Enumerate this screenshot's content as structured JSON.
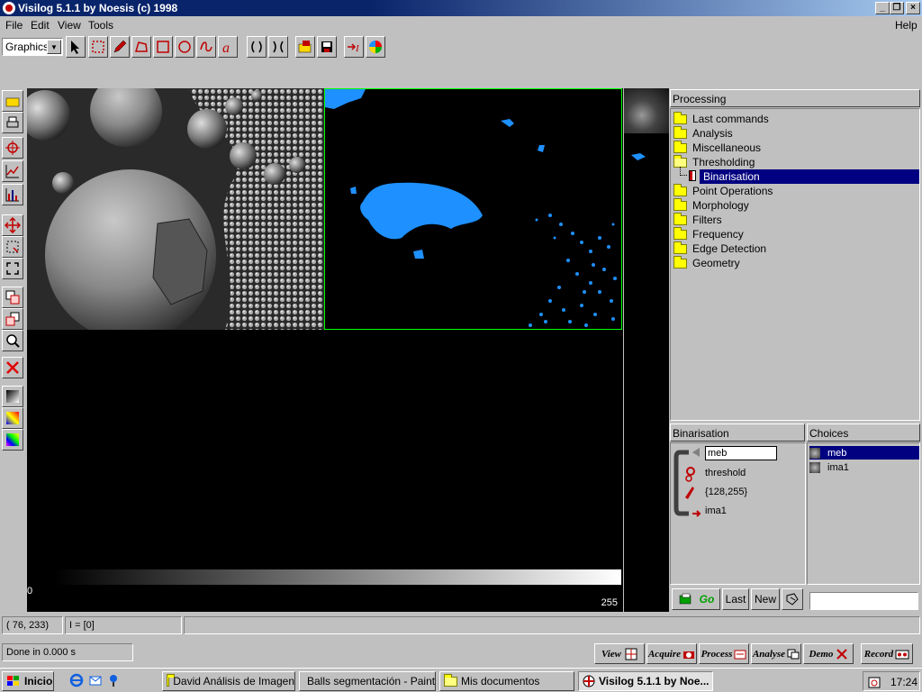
{
  "window": {
    "title": "Visilog 5.1.1 by Noesis (c) 1998"
  },
  "menu": {
    "file": "File",
    "edit": "Edit",
    "view": "View",
    "tools": "Tools",
    "help": "Help"
  },
  "toolbar": {
    "mode_select": "Graphics"
  },
  "processing": {
    "header": "Processing",
    "items": [
      {
        "label": "Last commands"
      },
      {
        "label": "Analysis"
      },
      {
        "label": "Miscellaneous"
      },
      {
        "label": "Thresholding"
      },
      {
        "label": "Binarisation"
      },
      {
        "label": "Point Operations"
      },
      {
        "label": "Morphology"
      },
      {
        "label": "Filters"
      },
      {
        "label": "Frequency"
      },
      {
        "label": "Edge Detection"
      },
      {
        "label": "Geometry"
      }
    ]
  },
  "binarisation": {
    "header": "Binarisation",
    "output": "meb",
    "method": "threshold",
    "range": "{128,255}",
    "input": "ima1"
  },
  "choices": {
    "header": "Choices",
    "items": [
      "meb",
      "ima1"
    ]
  },
  "actions": {
    "go": "Go",
    "last": "Last",
    "new": "New"
  },
  "image_area": {
    "scale_min": "0",
    "scale_max": "255"
  },
  "status": {
    "coords": "( 76, 233)",
    "intensity": "I = [0]",
    "message": "Done in 0.000 s"
  },
  "modes": {
    "view": "View",
    "acquire": "Acquire",
    "process": "Process",
    "analyse": "Analyse",
    "demo": "Demo",
    "record": "Record"
  },
  "taskbar": {
    "start": "Inicio",
    "tasks": [
      "David Análisis de Imagen",
      "Balls segmentación - Paint",
      "Mis documentos",
      "Visilog 5.1.1 by Noe..."
    ],
    "clock": "17:24"
  },
  "colors": {
    "title_active": "#0a246a",
    "selection": "#000080",
    "binary_blue": "#1e90ff",
    "frame_green": "#00ff00"
  }
}
